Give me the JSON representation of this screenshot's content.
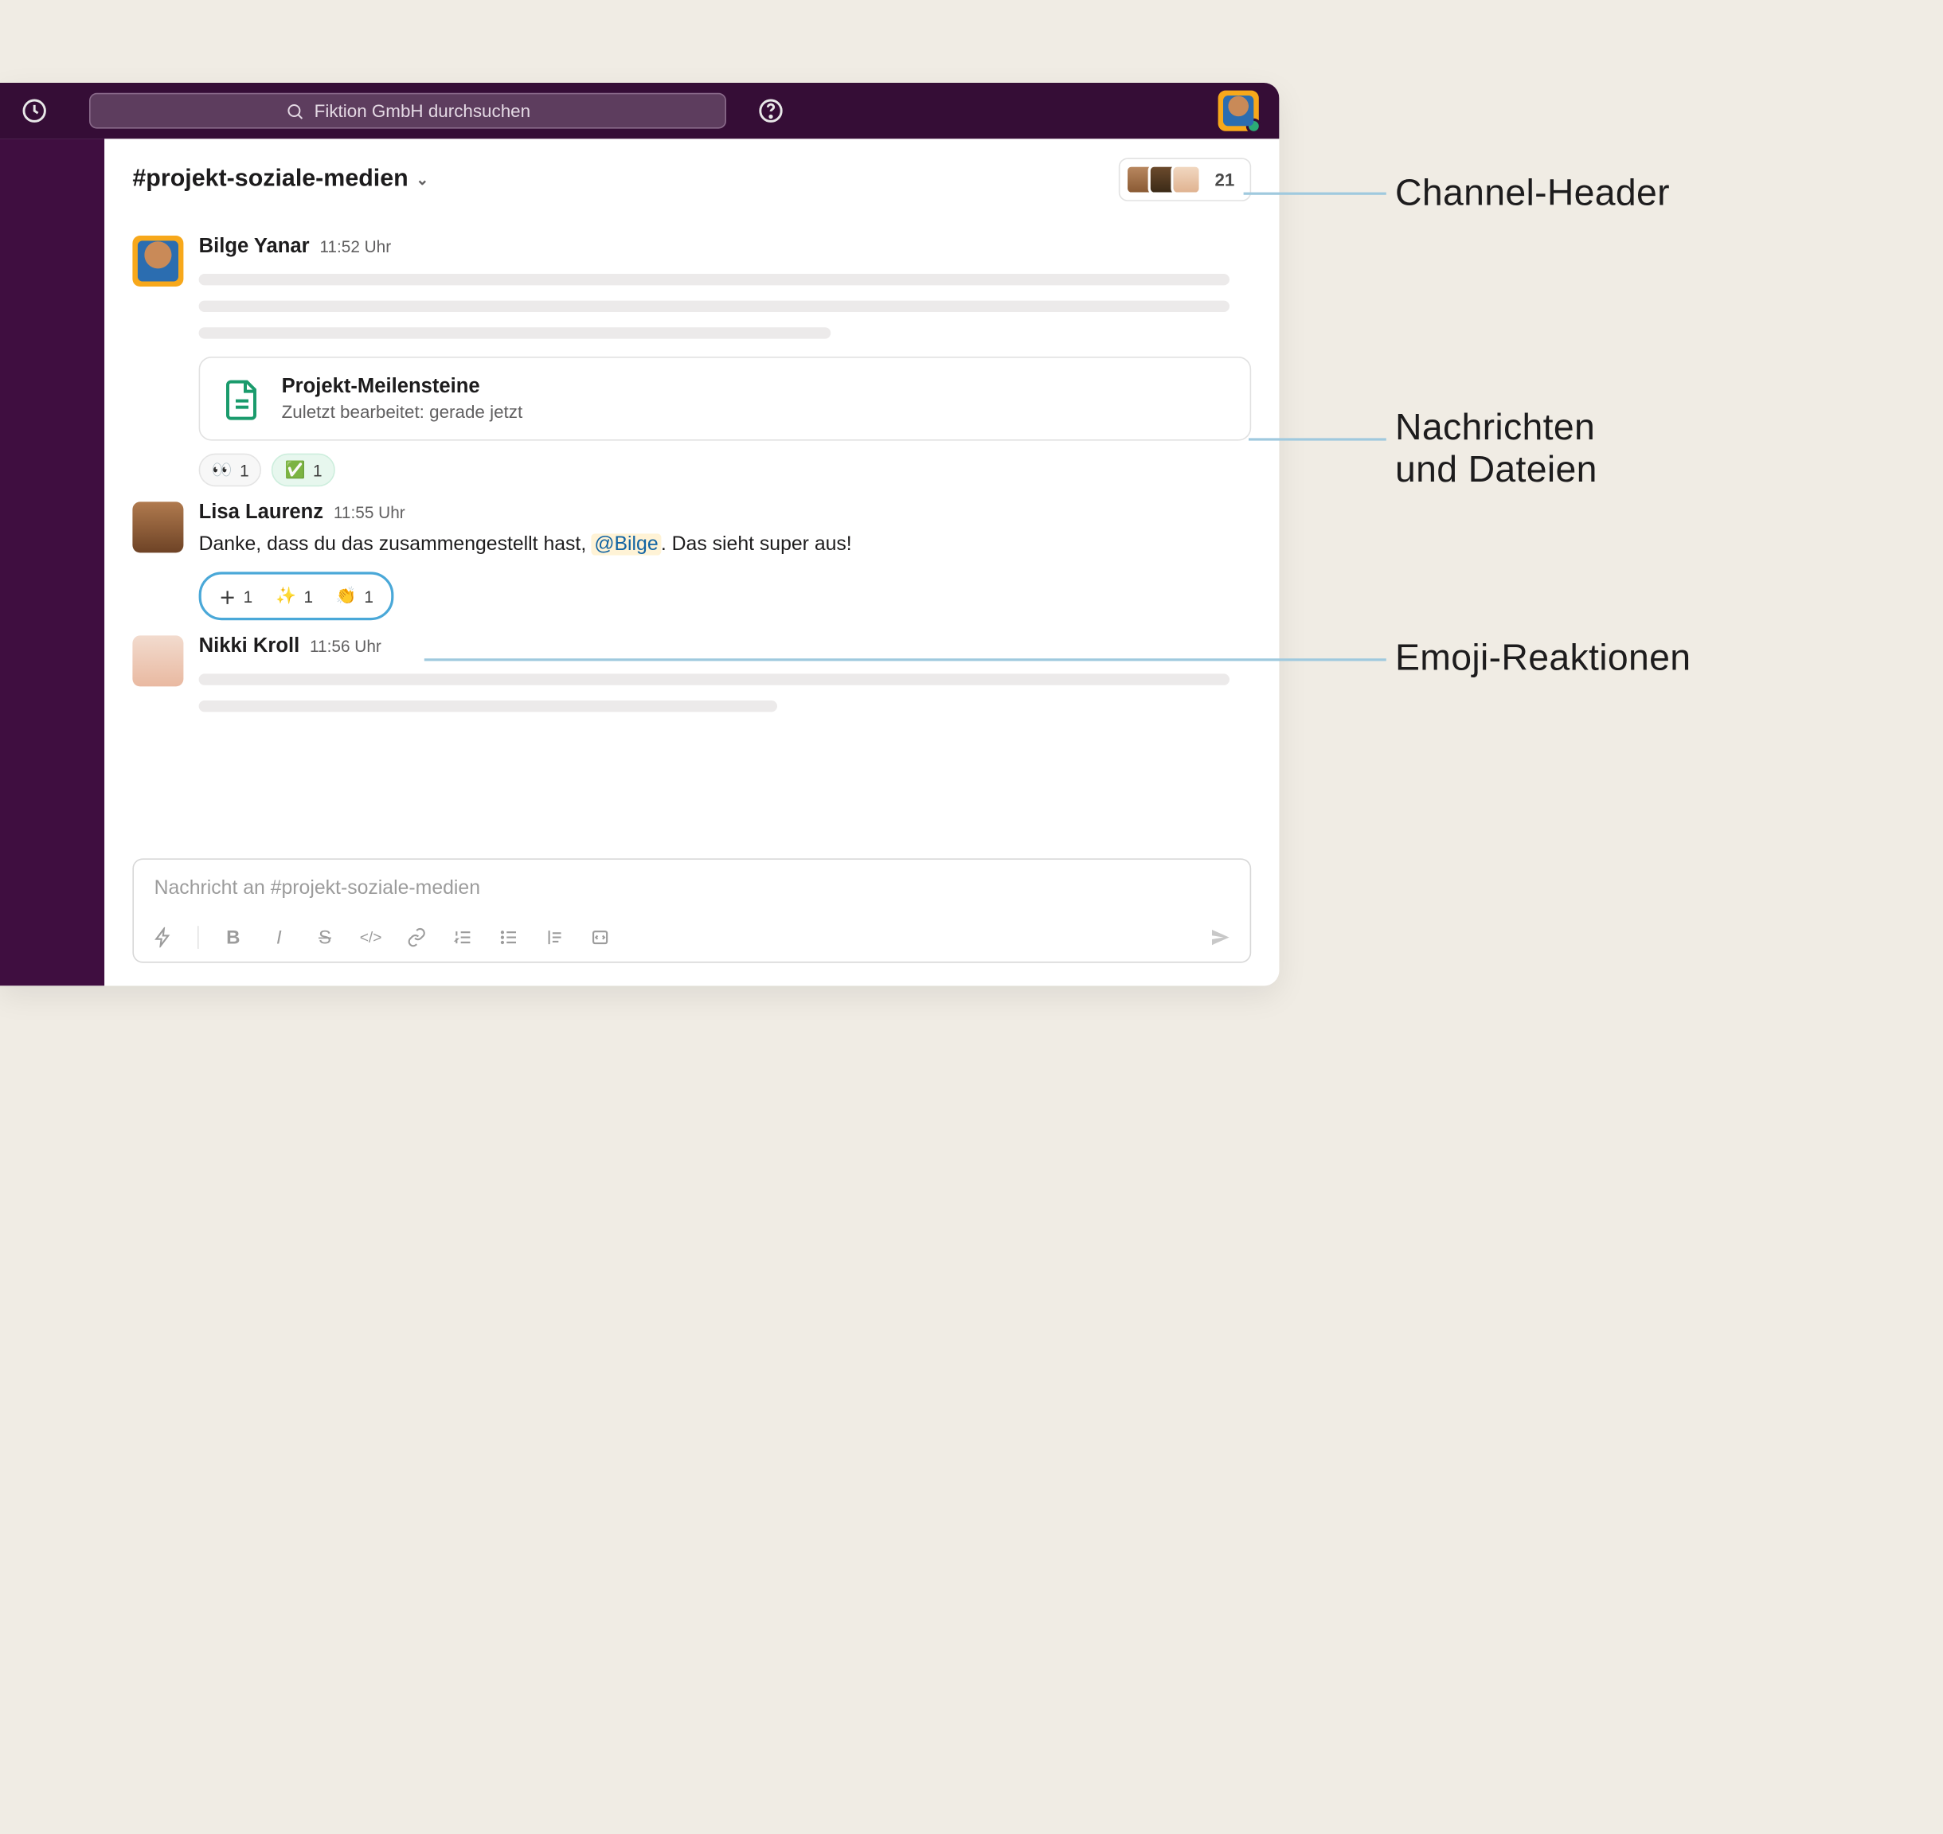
{
  "topbar": {
    "search_placeholder": "Fiktion GmbH durchsuchen"
  },
  "channel": {
    "name": "#projekt-soziale-medien",
    "member_count": "21"
  },
  "messages": [
    {
      "author": "Bilge Yanar",
      "time": "11:52 Uhr",
      "file": {
        "title": "Projekt-Meilensteine",
        "subtitle": "Zuletzt bearbeitet: gerade jetzt"
      },
      "reactions": [
        {
          "icon": "eyes",
          "count": "1"
        },
        {
          "icon": "check-green",
          "count": "1"
        }
      ]
    },
    {
      "author": "Lisa Laurenz",
      "time": "11:55 Uhr",
      "text_before": "Danke, dass du das zusammengestellt hast, ",
      "mention": "@Bilge",
      "text_after": ". Das sieht super aus!",
      "reactions": [
        {
          "icon": "plus",
          "count": "1"
        },
        {
          "icon": "sparkles",
          "count": "1"
        },
        {
          "icon": "clap",
          "count": "1"
        }
      ]
    },
    {
      "author": "Nikki Kroll",
      "time": "11:56 Uhr"
    }
  ],
  "composer": {
    "placeholder": "Nachricht an #projekt-soziale-medien"
  },
  "annotations": {
    "header": "Channel-Header",
    "messages_files_line1": "Nachrichten",
    "messages_files_line2": "und Dateien",
    "reactions": "Emoji-Reaktionen"
  },
  "emoji": {
    "eyes": "👀",
    "check-green": "✅",
    "plus": "＋",
    "sparkles": "✨",
    "clap": "👏"
  }
}
